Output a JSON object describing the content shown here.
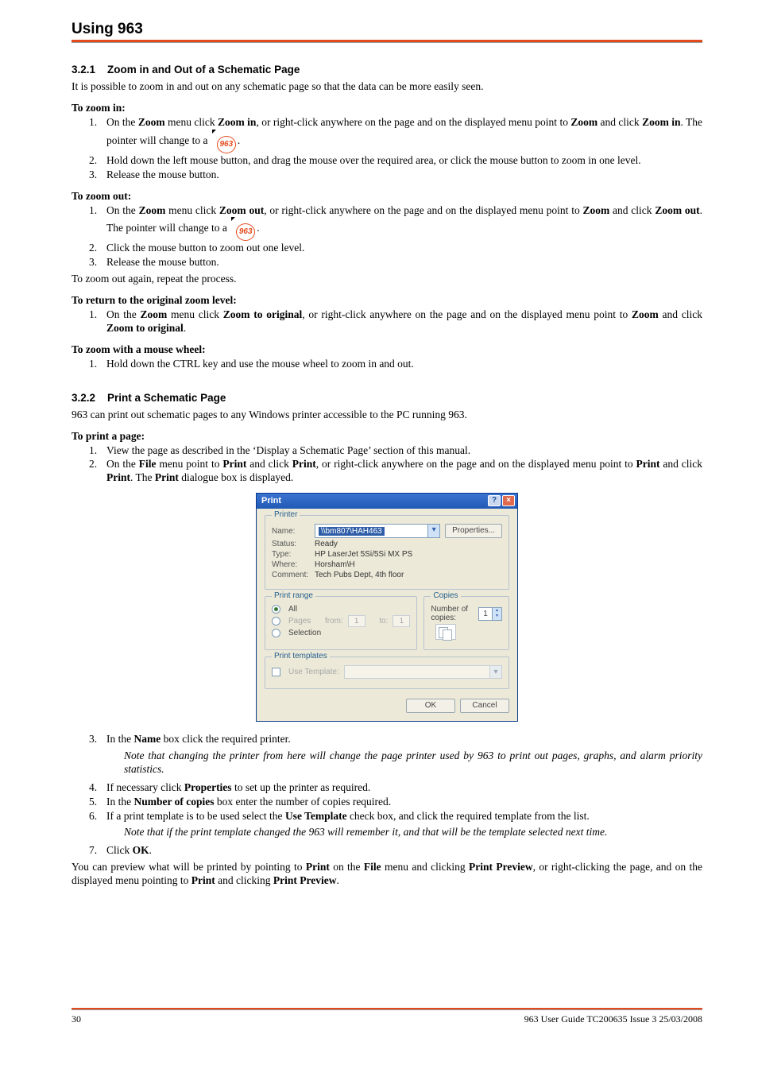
{
  "header": {
    "title": "Using 963"
  },
  "icon_label": "963",
  "sections": {
    "s1": {
      "num": "3.2.1",
      "title": "Zoom in and Out of a Schematic Page"
    },
    "s2": {
      "num": "3.2.2",
      "title": "Print a Schematic Page"
    }
  },
  "intro1": "It is possible to zoom in and out on any schematic page so that the data can be more easily seen.",
  "zoom_in": {
    "lead": "To zoom in:",
    "steps": [
      {
        "n": "1.",
        "pre": "On the ",
        "b1": "Zoom",
        "mid1": " menu click ",
        "b2": "Zoom in",
        "mid2": ", or right-click anywhere on the page and on the displayed menu point to ",
        "b3": "Zoom",
        "mid3": " and click ",
        "b4": "Zoom in",
        "tail": ". The pointer will change to a ",
        "after_icon": "."
      },
      {
        "n": "2.",
        "text": "Hold down the left mouse button, and drag the mouse over the required area, or click the mouse button to zoom in one level."
      },
      {
        "n": "3.",
        "text": "Release the mouse button."
      }
    ]
  },
  "zoom_out": {
    "lead": "To zoom out:",
    "steps": [
      {
        "n": "1.",
        "pre": "On the ",
        "b1": "Zoom",
        "mid1": " menu click ",
        "b2": "Zoom out",
        "mid2": ", or right-click anywhere on the page and on the displayed menu point to ",
        "b3": "Zoom",
        "mid3": " and click ",
        "b4": "Zoom out",
        "tail": ". The pointer will change to a ",
        "after_icon": "."
      },
      {
        "n": "2.",
        "text": "Click the mouse button to zoom out one level."
      },
      {
        "n": "3.",
        "text": "Release the mouse button."
      }
    ],
    "repeat": "To zoom out again, repeat the process."
  },
  "zoom_orig": {
    "lead": "To return to the original zoom level:",
    "step": {
      "n": "1.",
      "pre": "On the ",
      "b1": "Zoom",
      "mid1": " menu click ",
      "b2": "Zoom to original",
      "mid2": ", or right-click anywhere on the page and on the displayed menu point to ",
      "b3": "Zoom",
      "mid3": " and click ",
      "b4": "Zoom to original",
      "tail": "."
    }
  },
  "zoom_wheel": {
    "lead": "To zoom with a mouse wheel:",
    "step": {
      "n": "1.",
      "text": "Hold down the CTRL key and use the mouse wheel to zoom in and out."
    }
  },
  "print_intro": "963 can print out schematic pages to any Windows printer accessible to the PC running 963.",
  "print_lead": "To print a page:",
  "print_steps12": [
    {
      "n": "1.",
      "text": "View the page as described in the ‘Display a Schematic Page’ section of this manual."
    },
    {
      "n": "2.",
      "pre": "On the ",
      "b1": "File",
      "mid1": " menu point to ",
      "b2": "Print",
      "mid2": " and click ",
      "b3": "Print",
      "mid3": ", or right-click anywhere on the page and on the displayed menu point to ",
      "b4": "Print",
      "mid4": " and click ",
      "b5": "Print",
      "mid5": ". The ",
      "b6": "Print",
      "tail": " dialogue box is displayed."
    }
  ],
  "dialog": {
    "title": "Print",
    "help": "?",
    "close": "×",
    "printer": {
      "legend": "Printer",
      "name_lbl": "Name:",
      "name_val": "\\\\bm807\\HAH463",
      "prop_btn": "Properties...",
      "status_lbl": "Status:",
      "status_val": "Ready",
      "type_lbl": "Type:",
      "type_val": "HP LaserJet 5Si/5Si MX PS",
      "where_lbl": "Where:",
      "where_val": "Horsham\\H",
      "comment_lbl": "Comment:",
      "comment_val": "Tech Pubs Dept, 4th floor"
    },
    "range": {
      "legend": "Print range",
      "all": "All",
      "pages": "Pages",
      "from": "from:",
      "from_v": "1",
      "to": "to:",
      "to_v": "1",
      "sel": "Selection"
    },
    "copies": {
      "legend": "Copies",
      "num_lbl": "Number of copies:",
      "num_val": "1"
    },
    "templates": {
      "legend": "Print templates",
      "use": "Use Template:"
    },
    "ok": "OK",
    "cancel": "Cancel"
  },
  "print_steps_3to7": {
    "s3": {
      "n": "3.",
      "pre": "In the ",
      "b1": "Name",
      "tail": " box click the required printer."
    },
    "note1": "Note that changing the printer from here will change the page printer used by 963 to print out pages, graphs, and alarm priority statistics.",
    "s4": {
      "n": "4.",
      "pre": "If necessary click ",
      "b1": "Properties",
      "tail": " to set up the printer as required."
    },
    "s5": {
      "n": "5.",
      "pre": "In the ",
      "b1": "Number of copies",
      "tail": " box enter the number of copies required."
    },
    "s6": {
      "n": "6.",
      "pre": "If a print template is to be used select the ",
      "b1": "Use Template",
      "tail": " check box, and click the required template from the list."
    },
    "note2": "Note that if the print template changed the 963 will remember it, and that will be the template selected next time.",
    "s7": {
      "n": "7.",
      "pre": "Click ",
      "b1": "OK",
      "tail": "."
    }
  },
  "closing": {
    "pre": "You can preview what will be printed by pointing to ",
    "b1": "Print",
    "mid1": " on the ",
    "b2": "File",
    "mid2": " menu and clicking ",
    "b3": "Print Preview",
    "mid3": ", or right-clicking the page, and on the displayed menu pointing to ",
    "b4": "Print",
    "mid4": " and clicking ",
    "b5": "Print Preview",
    "tail": "."
  },
  "footer": {
    "page": "30",
    "doc": "963 User Guide TC200635 Issue 3 25/03/2008"
  }
}
